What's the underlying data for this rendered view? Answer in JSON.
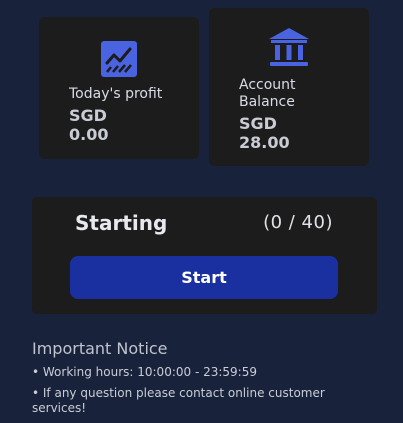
{
  "profit_card": {
    "label": "Today's profit",
    "currency": "SGD",
    "value": "0.00",
    "icon": "chart-up-icon"
  },
  "balance_card": {
    "label": "Account Balance",
    "currency": "SGD",
    "value": "28.00",
    "icon": "bank-icon"
  },
  "task": {
    "title": "Starting",
    "counter": "(0 / 40)",
    "button_label": "Start"
  },
  "notice": {
    "title": "Important Notice",
    "items": [
      "• Working hours: 10:00:00 - 23:59:59",
      "• If any question please contact online customer services!"
    ]
  },
  "colors": {
    "background": "#18223a",
    "card": "#1c1c1c",
    "accent": "#1a2fa0",
    "icon": "#4a63e0"
  }
}
